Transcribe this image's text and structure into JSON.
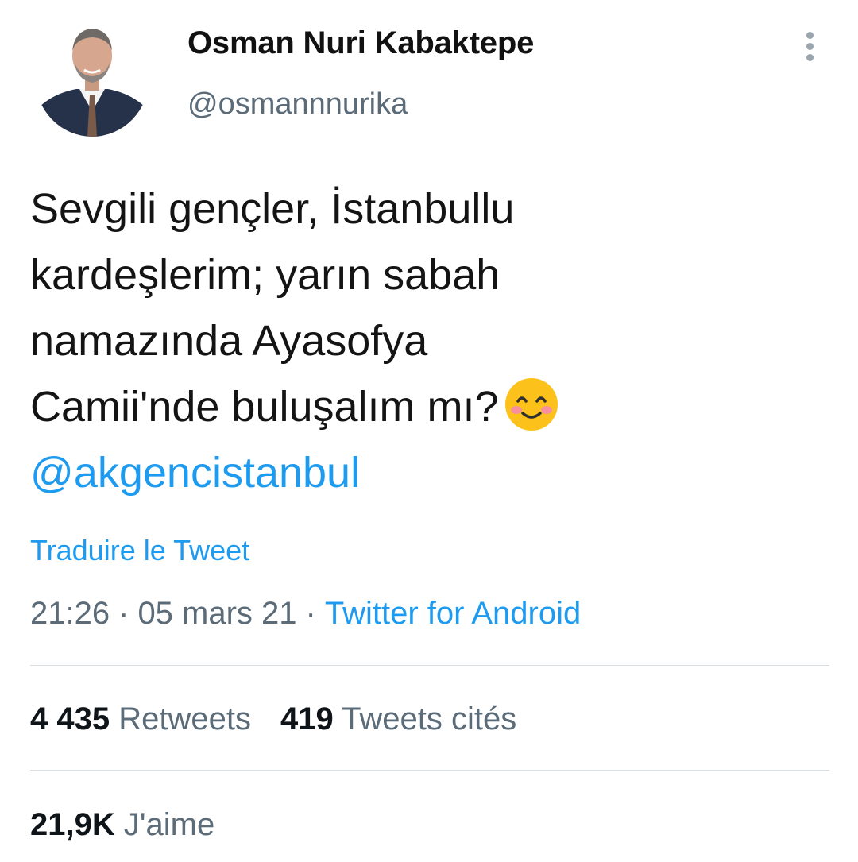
{
  "author": {
    "display_name": "Osman Nuri Kabaktepe",
    "handle": "@osmannnurika"
  },
  "menu": {
    "icon": "more-vertical-icon"
  },
  "tweet": {
    "lines": [
      "Sevgili gençler, İstanbullu",
      "kardeşlerim; yarın sabah",
      "namazında Ayasofya",
      "Camii'nde buluşalım mı?"
    ],
    "emoji": "smiling-face-with-smiling-eyes-emoji",
    "mention": "@akgencistanbul"
  },
  "translate_label": "Traduire le Tweet",
  "meta": {
    "time": "21:26",
    "separator": "·",
    "date": "05 mars 21",
    "source": "Twitter for Android"
  },
  "stats": {
    "retweets_count": "4 435",
    "retweets_label": "Retweets",
    "quotes_count": "419",
    "quotes_label": "Tweets cités",
    "likes_count": "21,9K",
    "likes_label": "J'aime"
  },
  "colors": {
    "accent": "#1d9bf0",
    "secondary_text": "#5b6b78",
    "divider": "#d9dee2"
  }
}
